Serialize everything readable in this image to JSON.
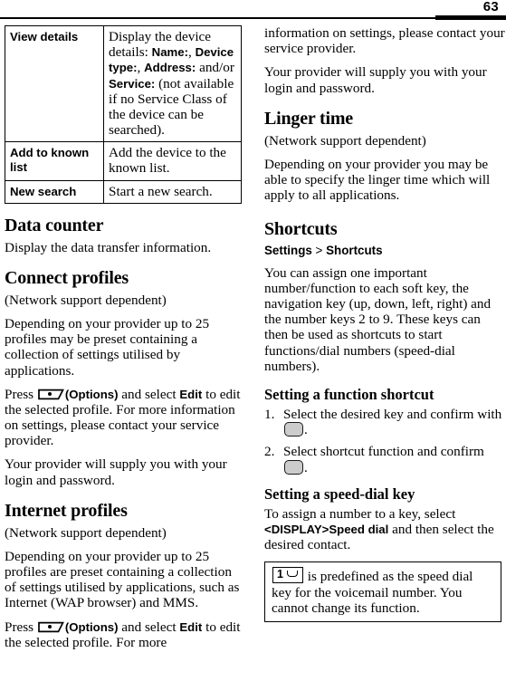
{
  "header": {
    "page_number": "63"
  },
  "left_column": {
    "options_table": {
      "rows": [
        {
          "key": "View details",
          "value_prefix": "Display the device details: ",
          "value_bold_1": "Name:",
          "value_mid_1": ", ",
          "value_bold_2": "Device type:",
          "value_mid_2": ", ",
          "value_bold_3": "Address:",
          "value_mid_3": " and/or ",
          "value_bold_4": "Service:",
          "value_suffix": " (not available if no Service Class of the device can be searched)."
        },
        {
          "key": "Add to known list",
          "value": "Add the device to the known list."
        },
        {
          "key": "New search",
          "value": "Start a new search."
        }
      ]
    },
    "data_counter": {
      "heading": "Data counter",
      "body": "Display the data transfer information."
    },
    "connect_profiles": {
      "heading": "Connect profiles",
      "note": "(Network support dependent)",
      "para1": "Depending on your provider up to 25 profiles may be preset containing a collection of settings utilised by applications.",
      "press_prefix": "Press ",
      "options_label": "(Options)",
      "press_mid": " and select ",
      "edit_label": "Edit",
      "press_suffix": " to edit the selected profile. For more information on settings, please contact your service provider.",
      "para3": "Your provider will supply you with your login and password."
    },
    "internet_profiles": {
      "heading": "Internet profiles",
      "note": "(Network support dependent)",
      "para1": "Depending on your provider up to 25 profiles are preset containing a collection of settings utilised by applications, such as Internet (WAP browser) and MMS.",
      "press_prefix": "Press ",
      "options_label": "(Options)",
      "press_mid": " and select ",
      "edit_label": "Edit",
      "press_suffix": " to edit the selected profile. For more"
    }
  },
  "right_column": {
    "continuation": {
      "para1": "information on settings, please contact your service provider.",
      "para2": "Your provider will supply you with your login and password."
    },
    "linger_time": {
      "heading": "Linger time",
      "note": "(Network support dependent)",
      "body": "Depending on your provider you may be able to specify the linger time which will apply to all applications."
    },
    "shortcuts": {
      "heading": "Shortcuts",
      "breadcrumb_first": "Settings",
      "breadcrumb_sep": " > ",
      "breadcrumb_second": "Shortcuts",
      "body": "You can assign one important number/function to each soft key, the navigation key (up, down, left, right) and the number keys 2 to 9. These keys can then be used as shortcuts to start functions/dial numbers (speed-dial numbers)."
    },
    "function_shortcut": {
      "heading": "Setting a function shortcut",
      "steps": [
        {
          "num": "1.",
          "text_before": "Select the desired key and confirm with ",
          "text_after": "."
        },
        {
          "num": "2.",
          "text_before": "Select shortcut function and confirm ",
          "text_after": "."
        }
      ]
    },
    "speed_dial": {
      "heading": "Setting a speed-dial key",
      "body_prefix": "To assign a number to a key, select ",
      "body_bold": "<DISPLAY>Speed dial",
      "body_suffix": " and then select the desired contact.",
      "note_box": {
        "text": " is predefined as the speed dial key for the voicemail number. You cannot change its function."
      }
    }
  },
  "icons": {
    "softkey_options": "softkey-options-icon",
    "confirm_key": "confirm-key-icon",
    "speed_dial_one_key": "key-1-voicemail-icon"
  }
}
